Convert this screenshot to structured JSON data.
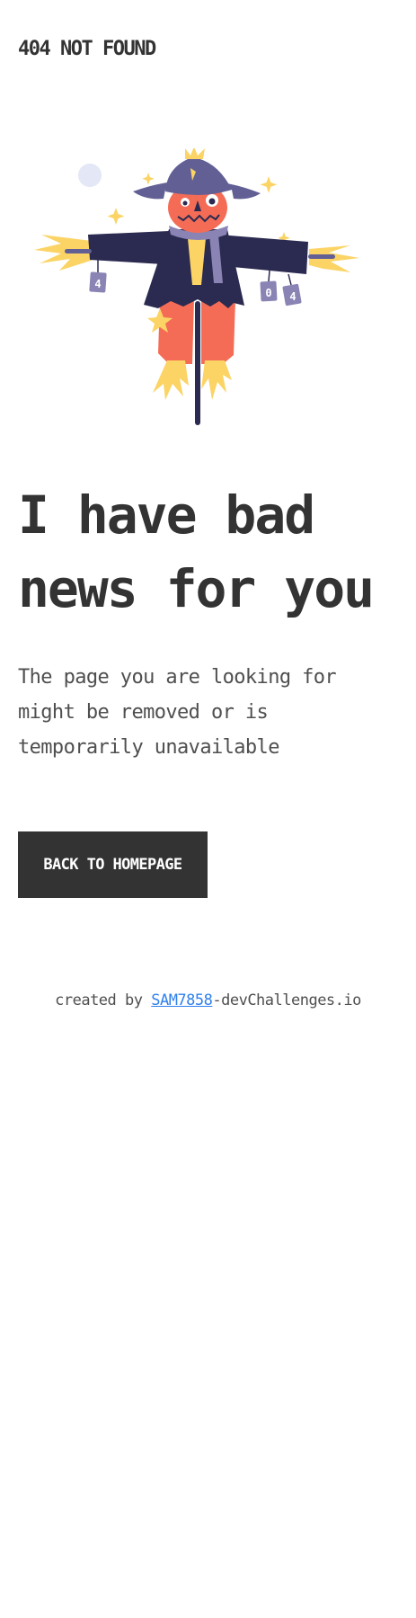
{
  "header": {
    "title": "404 NOT FOUND"
  },
  "illustration": {
    "name": "scarecrow-illustration",
    "can_labels": [
      "4",
      "0",
      "4"
    ]
  },
  "main": {
    "headline": "I have bad news for you",
    "description": "The page you are looking for might be removed or is temporarily unavailable",
    "cta_label": "BACK TO HOMEPAGE"
  },
  "footer": {
    "prefix": "created by ",
    "author": "SAM7858",
    "suffix": "-devChallenges.io"
  },
  "colors": {
    "text": "#333333",
    "muted_text": "#4f4f4f",
    "button_bg": "#333333",
    "button_text": "#ffffff",
    "link": "#2f80ed",
    "straw": "#fbd465",
    "coat": "#2b2a50",
    "face": "#f46c56",
    "hat": "#625f95",
    "can": "#8a84b5"
  }
}
